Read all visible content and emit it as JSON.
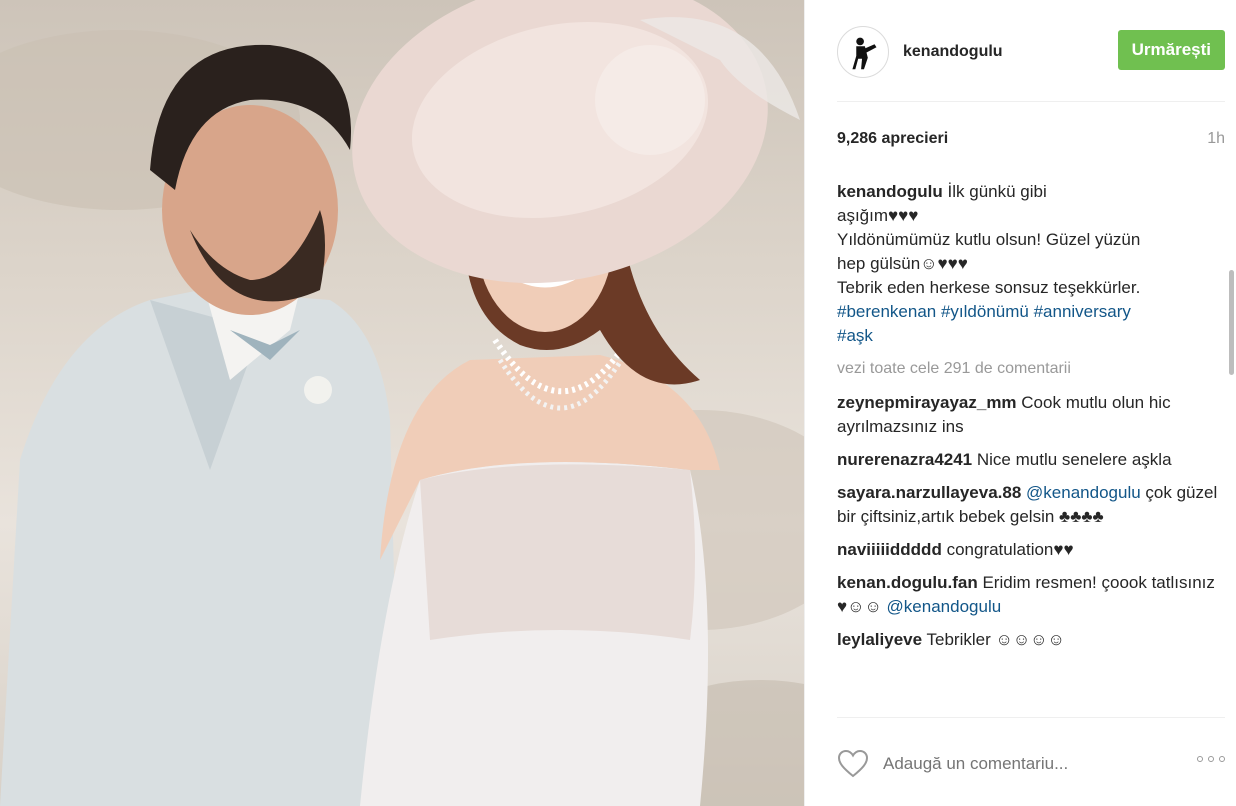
{
  "post": {
    "username": "kenandogulu",
    "follow_label": "Urmărești",
    "likes": "9,286 aprecieri",
    "time": "1h"
  },
  "caption": {
    "username": "kenandogulu",
    "lines": [
      "İlk günkü gibi",
      "aşığım♥♥♥",
      "Yıldönümümüz kutlu olsun! Güzel yüzün",
      "hep gülsün☺♥♥♥",
      "Tebrik eden herkese sonsuz teşekkürler."
    ],
    "hashtags_line1": "#berenkenan #yıldönümü #anniversary",
    "hashtags_line2": "#aşk"
  },
  "view_all": "vezi toate cele 291 de comentarii",
  "comments": [
    {
      "username": "zeynepmirayayaz_mm",
      "text": "Cook mutlu olun hic ayrılmazsınız ins"
    },
    {
      "username": "nurerenazra4241",
      "text": "Nice mutlu senelere aşkla"
    },
    {
      "username": "sayara.narzullayeva.88",
      "mention": "@kenandogulu",
      "text": "çok güzel bir çiftsiniz,artık bebek gelsin ♣♣♣♣"
    },
    {
      "username": "naviiiiiddddd",
      "text": "congratulation♥♥"
    },
    {
      "username": "kenan.dogulu.fan",
      "text": "Eridim resmen! çoook tatlısınız ♥☺☺",
      "mention": "@kenandogulu"
    },
    {
      "username": "leylaliyeve",
      "text": "Tebrikler ☺☺☺☺"
    }
  ],
  "comment_input": {
    "placeholder": "Adaugă un comentariu..."
  },
  "colors": {
    "follow": "#70c050",
    "hashtag": "#125688",
    "muted": "#999999"
  },
  "icons": [
    "heart-icon",
    "more-options-icon",
    "avatar-icon"
  ]
}
